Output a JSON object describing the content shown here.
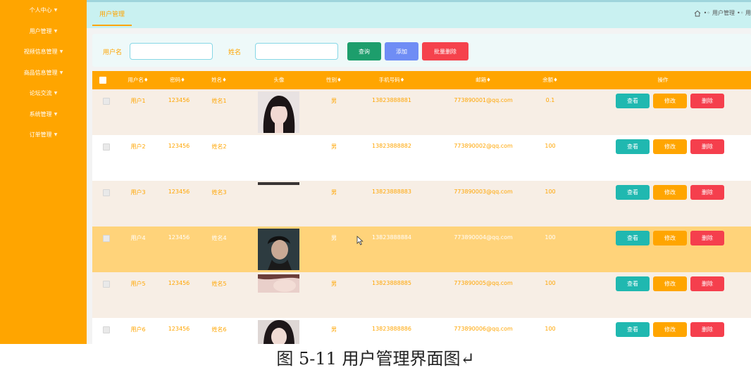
{
  "sidebar": {
    "items": [
      {
        "label": "个人中心"
      },
      {
        "label": "用户管理"
      },
      {
        "label": "视频信息管理"
      },
      {
        "label": "商品信息管理"
      },
      {
        "label": "论坛交流"
      },
      {
        "label": "系统管理"
      },
      {
        "label": "订单管理"
      }
    ]
  },
  "tabbar": {
    "active_tab": "用户管理",
    "breadcrumb": {
      "sep": "•◦",
      "item": "用户管理",
      "tail": "•◦ 用"
    }
  },
  "search": {
    "username_label": "用户名",
    "username_value": "",
    "name_label": "姓名",
    "name_value": "",
    "query_button": "查询",
    "add_button": "添加",
    "batch_delete_button": "批量删除"
  },
  "table": {
    "headers": [
      "用户名♦",
      "密码♦",
      "姓名♦",
      "头像",
      "性别♦",
      "手机号码♦",
      "邮箱♦",
      "余额♦",
      "操作"
    ],
    "actions": {
      "view": "查看",
      "edit": "修改",
      "delete": "删除"
    },
    "rows": [
      {
        "username": "用户1",
        "password": "123456",
        "name": "姓名1",
        "avatar": "portrait-1",
        "gender": "男",
        "phone": "13823888881",
        "email": "773890001@qq.com",
        "balance": "0.1"
      },
      {
        "username": "用户2",
        "password": "123456",
        "name": "姓名2",
        "avatar": "none",
        "gender": "男",
        "phone": "13823888882",
        "email": "773890002@qq.com",
        "balance": "100"
      },
      {
        "username": "用户3",
        "password": "123456",
        "name": "姓名3",
        "avatar": "strip",
        "gender": "男",
        "phone": "13823888883",
        "email": "773890003@qq.com",
        "balance": "100"
      },
      {
        "username": "用户4",
        "password": "123456",
        "name": "姓名4",
        "avatar": "portrait-4",
        "gender": "男",
        "phone": "13823888884",
        "email": "773890004@qq.com",
        "balance": "100"
      },
      {
        "username": "用户5",
        "password": "123456",
        "name": "姓名5",
        "avatar": "portrait-5",
        "gender": "男",
        "phone": "13823888885",
        "email": "773890005@qq.com",
        "balance": "100"
      },
      {
        "username": "用户6",
        "password": "123456",
        "name": "姓名6",
        "avatar": "portrait-6",
        "gender": "男",
        "phone": "13823888886",
        "email": "773890006@qq.com",
        "balance": "100"
      }
    ]
  },
  "caption": "图 5-11 用户管理界面图↵",
  "colors": {
    "sidebar": "#ffa500",
    "header_bg": "#c9f1f1",
    "table_header": "#ffa500",
    "row_alt": "#f7eee5",
    "row_hover": "#ffd37a",
    "query": "#1d9e6c",
    "add": "#6f8df5",
    "delete": "#f53f4d",
    "view": "#20b8b0"
  }
}
